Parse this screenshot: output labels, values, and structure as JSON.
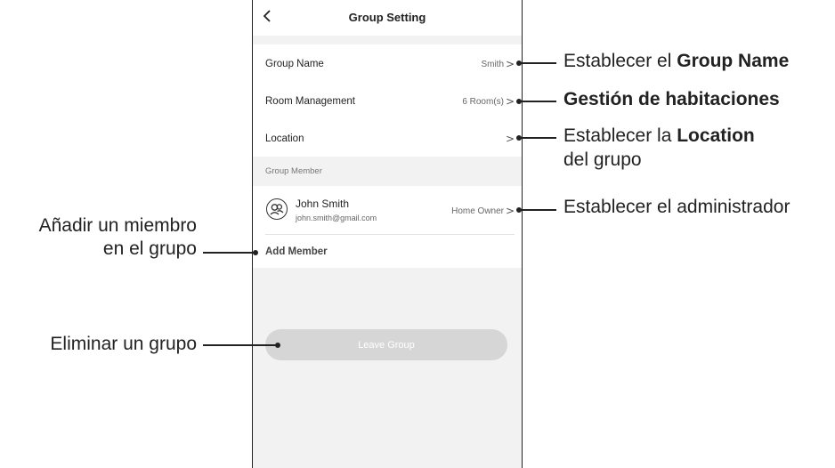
{
  "app": {
    "title": "Group Setting",
    "back_icon": "chevron-left-icon"
  },
  "settings": {
    "group_name_label": "Group Name",
    "group_name_value": "Smith",
    "room_management_label": "Room Management",
    "room_management_value": "6 Room(s)",
    "location_label": "Location",
    "chevron": ">"
  },
  "members": {
    "section_label": "Group Member",
    "items": [
      {
        "name": "John Smith",
        "email": "john.smith@gmail.com",
        "role": "Home Owner"
      }
    ],
    "add_label": "Add Member"
  },
  "actions": {
    "leave_label": "Leave Group"
  },
  "annotations": {
    "group_name_prefix": "Establecer el ",
    "group_name_bold": "Group Name",
    "rooms_bold": "Gestión de habitaciones",
    "location_prefix": "Establecer la ",
    "location_bold": "Location",
    "location_line2": "del grupo",
    "admin": "Establecer el administrador",
    "add_member_line1": "Añadir un miembro",
    "add_member_line2": "en el grupo",
    "leave_group": "Eliminar un grupo"
  },
  "colors": {
    "screen_background": "#f2f2f2",
    "card_background": "#ffffff",
    "leave_button": "#d6d6d6",
    "text": "#222222"
  }
}
